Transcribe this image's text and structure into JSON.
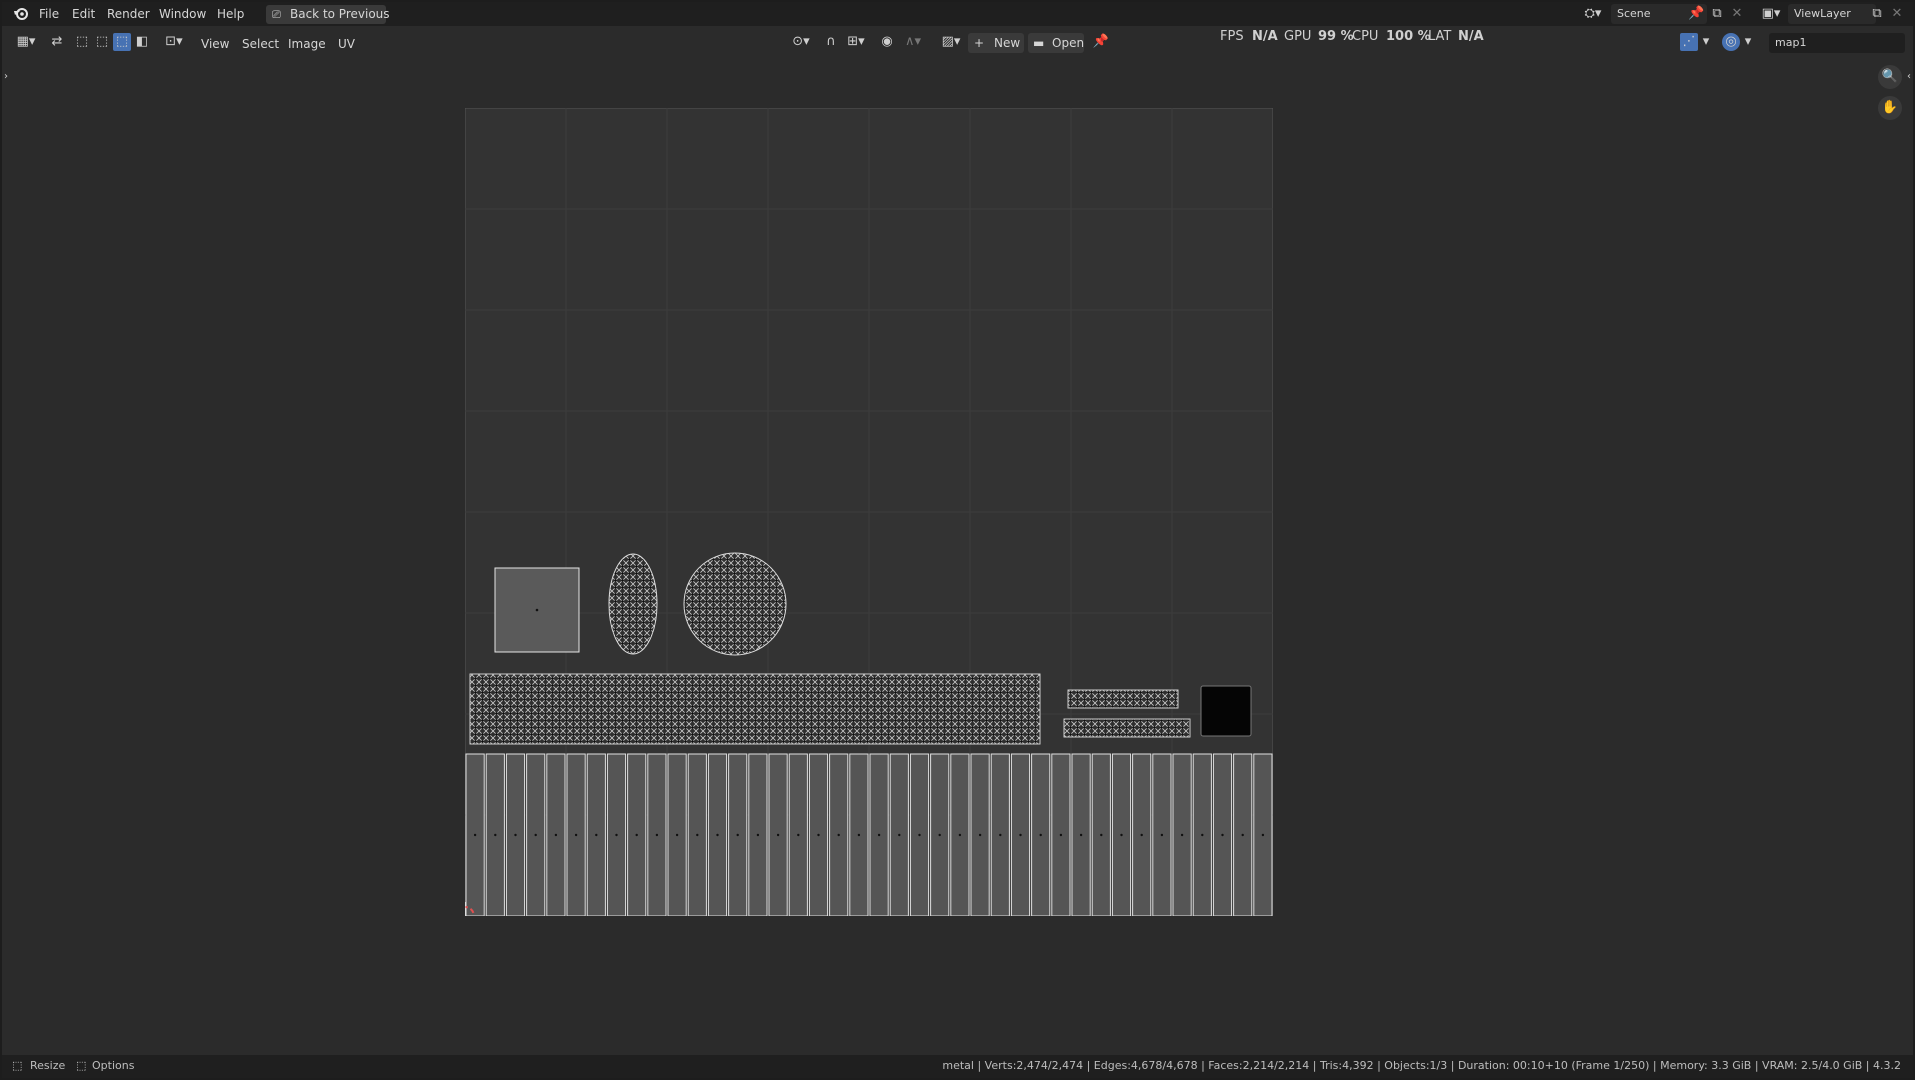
{
  "menu": {
    "items": [
      "File",
      "Edit",
      "Render",
      "Window",
      "Help"
    ],
    "back_to_previous": "Back to Previous"
  },
  "scene": {
    "label": "Scene"
  },
  "view_layer": {
    "label": "ViewLayer"
  },
  "header": {
    "menus": [
      "View",
      "Select",
      "Image",
      "UV"
    ],
    "new_label": "New",
    "open_label": "Open",
    "uv_map": "map1"
  },
  "stats": {
    "fps_label": "FPS",
    "fps_value": "N/A",
    "gpu_label": "GPU",
    "gpu_value": "99 %",
    "cpu_label": "CPU",
    "cpu_value": "100 %",
    "lat_label": "LAT",
    "lat_value": "N/A"
  },
  "status_bar": {
    "resize": "Resize",
    "options": "Options",
    "info": "metal | Verts:2,474/2,474 | Edges:4,678/4,678 | Faces:2,214/2,214 | Tris:4,392 | Objects:1/3 | Duration: 00:10+10 (Frame 1/250) | Memory: 3.3 GiB | VRAM: 2.5/4.0 GiB | 4.3.2"
  },
  "colors": {
    "background": "#2b2b2b",
    "uv_island_fill": "#5a5a5a",
    "uv_edge": "#e8e8e8",
    "cursor": "#e05050"
  },
  "icons": [
    "blender-logo-icon",
    "editor-type-icon",
    "sync-icon",
    "select-mode-icons",
    "pivot-icon",
    "snap-icon",
    "proportional-icon",
    "image-icon",
    "pin-icon",
    "overlay-icon",
    "gizmo-icon",
    "zoom-icon",
    "hand-icon",
    "scene-icon",
    "viewlayer-icon",
    "cursor-icon"
  ]
}
